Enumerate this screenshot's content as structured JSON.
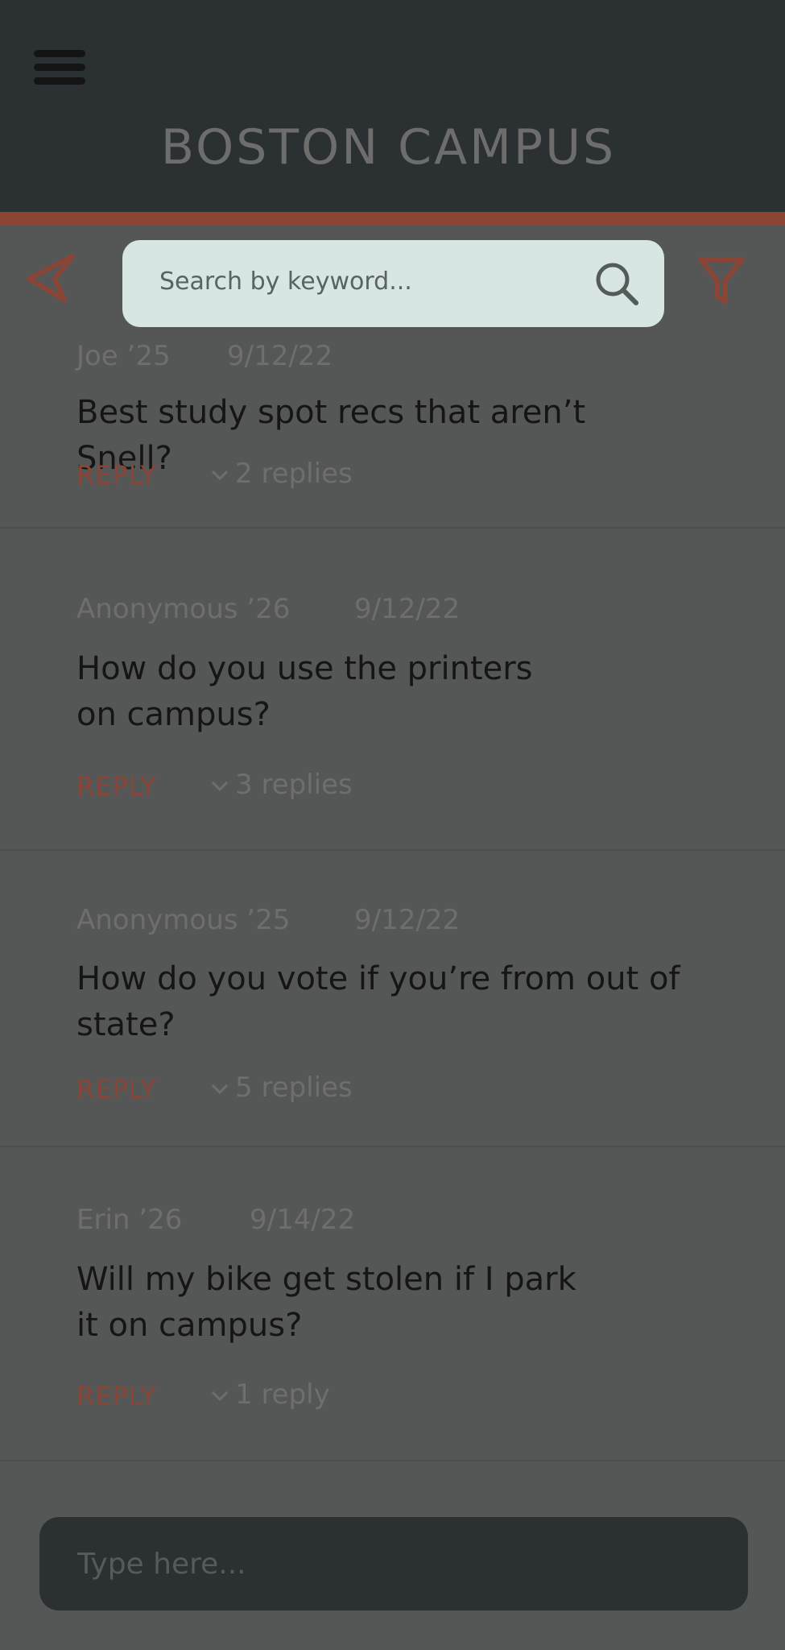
{
  "header": {
    "title": "BOSTON CAMPUS"
  },
  "search": {
    "placeholder": "Search by keyword..."
  },
  "posts": [
    {
      "author": "Joe ’25",
      "date": "9/12/22",
      "question": "Best study spot recs that aren’t Snell?",
      "reply_label": "REPLY",
      "replies_label": "2 replies"
    },
    {
      "author": "Anonymous ’26",
      "date": "9/12/22",
      "question": "How do you use the printers on campus?",
      "reply_label": "REPLY",
      "replies_label": "3 replies"
    },
    {
      "author": "Anonymous ’25",
      "date": "9/12/22",
      "question": "How do you vote if you’re from out of state?",
      "reply_label": "REPLY",
      "replies_label": "5 replies"
    },
    {
      "author": "Erin ’26",
      "date": "9/14/22",
      "question": "Will my bike get stolen if I park it on campus?",
      "reply_label": "REPLY",
      "replies_label": "1 reply"
    }
  ],
  "composer": {
    "placeholder": "Type here..."
  },
  "colors": {
    "header_bg": "#2b3133",
    "accent": "#8c4535",
    "search_bg": "#d7e5e3",
    "page_bg": "#555656"
  },
  "icons": {
    "menu": "hamburger-menu-icon",
    "back": "send-arrow-icon",
    "filter": "filter-funnel-icon",
    "search": "magnifier-icon",
    "chevron": "chevron-down-icon"
  }
}
